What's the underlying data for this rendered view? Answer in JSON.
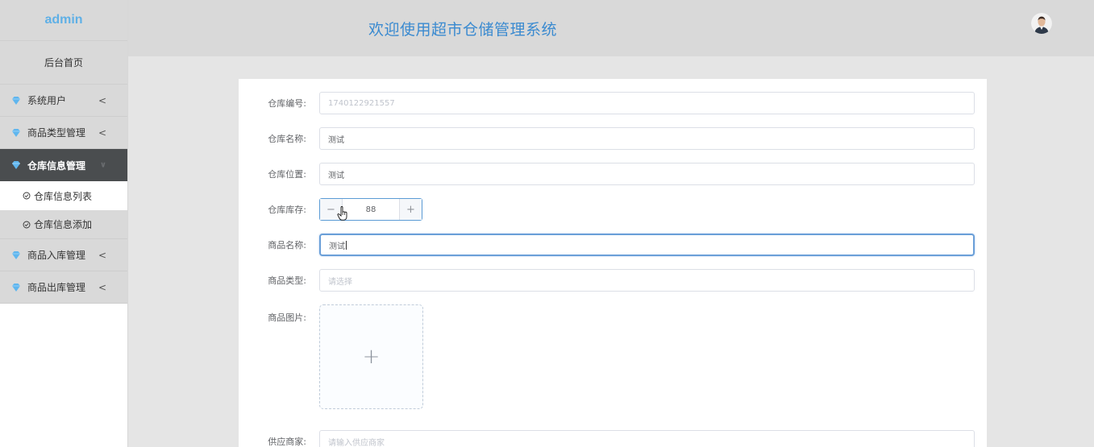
{
  "sidebar": {
    "brand": "admin",
    "home": "后台首页",
    "menu": [
      {
        "label": "系统用户",
        "arrow": "<"
      },
      {
        "label": "商品类型管理",
        "arrow": "<"
      },
      {
        "label": "仓库信息管理",
        "arrow": "∨"
      },
      {
        "label": "商品入库管理",
        "arrow": "<"
      },
      {
        "label": "商品出库管理",
        "arrow": "<"
      }
    ],
    "submenu": [
      {
        "label": "仓库信息列表"
      },
      {
        "label": "仓库信息添加"
      }
    ]
  },
  "header": {
    "title": "欢迎使用超市仓储管理系统"
  },
  "form": {
    "warehouse_no": {
      "label": "仓库编号:",
      "value": "1740122921557"
    },
    "warehouse_name": {
      "label": "仓库名称:",
      "value": "测试"
    },
    "warehouse_location": {
      "label": "仓库位置:",
      "value": "测试"
    },
    "warehouse_stock": {
      "label": "仓库库存:",
      "value": "88",
      "minus": "−",
      "plus": "+"
    },
    "product_name": {
      "label": "商品名称:",
      "value": "测试"
    },
    "product_type": {
      "label": "商品类型:",
      "placeholder": "请选择"
    },
    "product_image": {
      "label": "商品图片:",
      "upload_icon": "+"
    },
    "supplier": {
      "label": "供应商家:",
      "placeholder": "请输入供应商家"
    }
  },
  "colors": {
    "accent": "#3a8ad0",
    "gem": "#5fb6ee",
    "active_menu_bg": "#4a4d4f",
    "focus_border": "#6a9fd8"
  },
  "icons": {
    "gem": "diamond-icon",
    "clock": "clock-icon",
    "cursor": "hand-pointer-icon",
    "avatar": "user-avatar"
  }
}
